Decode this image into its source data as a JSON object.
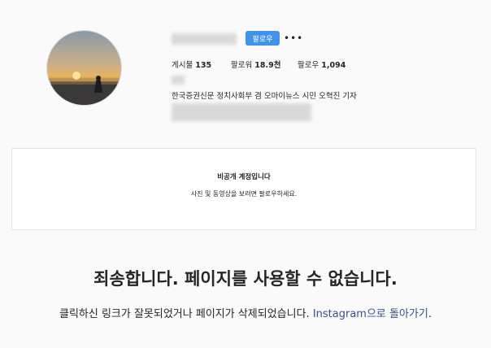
{
  "profile": {
    "follow_button": "팔로우",
    "more_icon": "more-horizontal-icon",
    "stats": {
      "posts": {
        "label": "게시물",
        "value": "135"
      },
      "followers": {
        "label": "팔로워",
        "value": "18.9천"
      },
      "following": {
        "label": "팔로우",
        "value": "1,094"
      }
    },
    "bio": "한국증권신문 정치사회부 겸 오마이뉴스 시민 오혁진 기자"
  },
  "private_notice": {
    "title": "비공개 계정입니다",
    "description": "사진 및 동영상을 보려면 팔로우하세요."
  },
  "error": {
    "headline": "죄송합니다. 페이지를 사용할 수 없습니다.",
    "message_prefix": "클릭하신 링크가 잘못되었거나 페이지가 삭제되었습니다. ",
    "link_text": "Instagram으로 돌아가기",
    "message_suffix": "."
  },
  "colors": {
    "follow_button": "#3f93e8",
    "link": "#385185"
  }
}
